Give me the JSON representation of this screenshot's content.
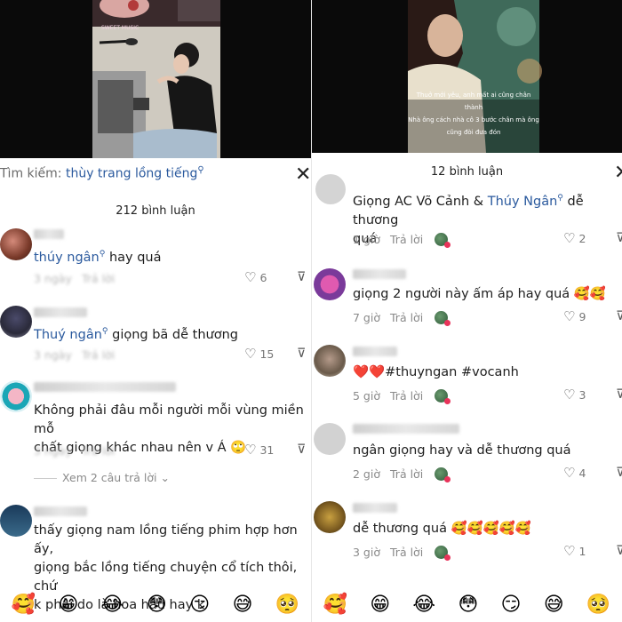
{
  "left": {
    "search": {
      "label": "Tìm kiếm:",
      "term": "thùy trang lồng tiếng",
      "icon": "search-icon"
    },
    "comment_count": "212 bình luận",
    "comments": [
      {
        "mention": "thúy ngân",
        "text": "hay quá",
        "time": "3 ngày",
        "reply": "Trả lời",
        "likes": "6"
      },
      {
        "mention": "Thuý ngân",
        "text": "giọng bã dễ thương",
        "time": "3 ngày",
        "reply": "Trả lời",
        "likes": "15"
      },
      {
        "text": "Không phải đâu mỗi người mỗi vùng miền mỗ\nchất giọng khác nhau nên v Á 🙄",
        "time": "3 ngày",
        "reply": "Trả lời",
        "likes": "31",
        "view_replies": "Xem 2 câu trả lời"
      },
      {
        "text": "thấy giọng nam lồng tiếng phim hợp hơn ấy,\ngiọng bắc lồng tiếng chuyện cổ tích thôi, chứ\nk phải do là hoa hậu hay k"
      }
    ],
    "emojis": [
      "🥰",
      "😁",
      "😂",
      "😳",
      "😏",
      "😅",
      "🥺"
    ]
  },
  "right": {
    "video_captions": [
      "Thuở mới yêu, anh mất ai cũng chân",
      "thành",
      "Nhà ông cách nhà cô 3 bước chân mà ông",
      "cũng đòi đưa đón"
    ],
    "comment_count": "12 bình luận",
    "comments": [
      {
        "prefix": "Giọng AC Võ Cảnh & ",
        "mention": "Thúy Ngân",
        "text": " dễ thương\nquá",
        "time": "1 giờ",
        "reply": "Trả lời",
        "likes": "2"
      },
      {
        "text": "giọng 2 người này ấm áp hay quá 🥰🥰",
        "time": "7 giờ",
        "reply": "Trả lời",
        "likes": "9"
      },
      {
        "text": "❤️❤️#thuyngan #vocanh",
        "time": "5 giờ",
        "reply": "Trả lời",
        "likes": "3"
      },
      {
        "text": "ngân giọng hay và dễ thương quá",
        "time": "2 giờ",
        "reply": "Trả lời",
        "likes": "4"
      },
      {
        "text": "dễ thương quá 🥰🥰🥰🥰🥰",
        "time": "3 giờ",
        "reply": "Trả lời",
        "likes": "1"
      }
    ],
    "emojis": [
      "🥰",
      "😁",
      "😂",
      "😳",
      "😏",
      "😅",
      "🥺"
    ]
  },
  "colors": {
    "mention": "#2b5a9e",
    "meta": "#8a8a8a",
    "video_bg": "#0a0a0a"
  }
}
